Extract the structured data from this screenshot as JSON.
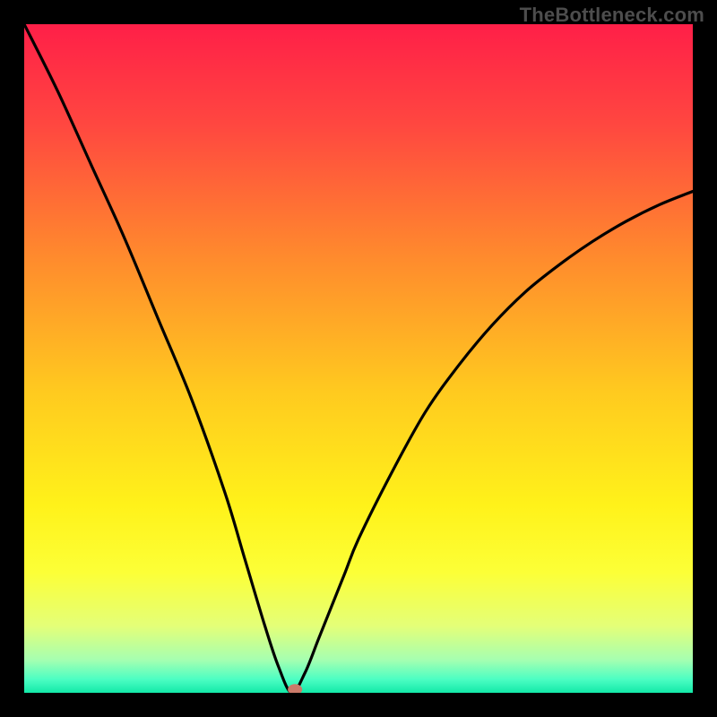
{
  "watermark": "TheBottleneck.com",
  "chart_data": {
    "type": "line",
    "title": "",
    "xlabel": "",
    "ylabel": "",
    "xlim": [
      0,
      100
    ],
    "ylim": [
      0,
      100
    ],
    "x": [
      0,
      5,
      10,
      15,
      20,
      25,
      30,
      33,
      36,
      38,
      40,
      42,
      44,
      46,
      48,
      50,
      55,
      60,
      65,
      70,
      75,
      80,
      85,
      90,
      95,
      100
    ],
    "values": [
      100,
      90,
      79,
      68,
      56,
      44,
      30,
      20,
      10,
      4,
      0,
      3,
      8,
      13,
      18,
      23,
      33,
      42,
      49,
      55,
      60,
      64,
      67.5,
      70.5,
      73,
      75
    ],
    "minimum_at_x": 40,
    "marker": {
      "x": 40.5,
      "y": 0.5
    },
    "background_gradient": {
      "stops": [
        {
          "offset": 0.0,
          "color": "#ff1f48"
        },
        {
          "offset": 0.15,
          "color": "#ff4740"
        },
        {
          "offset": 0.35,
          "color": "#ff8b2d"
        },
        {
          "offset": 0.55,
          "color": "#ffca1f"
        },
        {
          "offset": 0.72,
          "color": "#fff21a"
        },
        {
          "offset": 0.82,
          "color": "#fcff37"
        },
        {
          "offset": 0.9,
          "color": "#e4ff78"
        },
        {
          "offset": 0.95,
          "color": "#a7ffb0"
        },
        {
          "offset": 0.98,
          "color": "#4cfec3"
        },
        {
          "offset": 1.0,
          "color": "#12e9a8"
        }
      ]
    }
  }
}
